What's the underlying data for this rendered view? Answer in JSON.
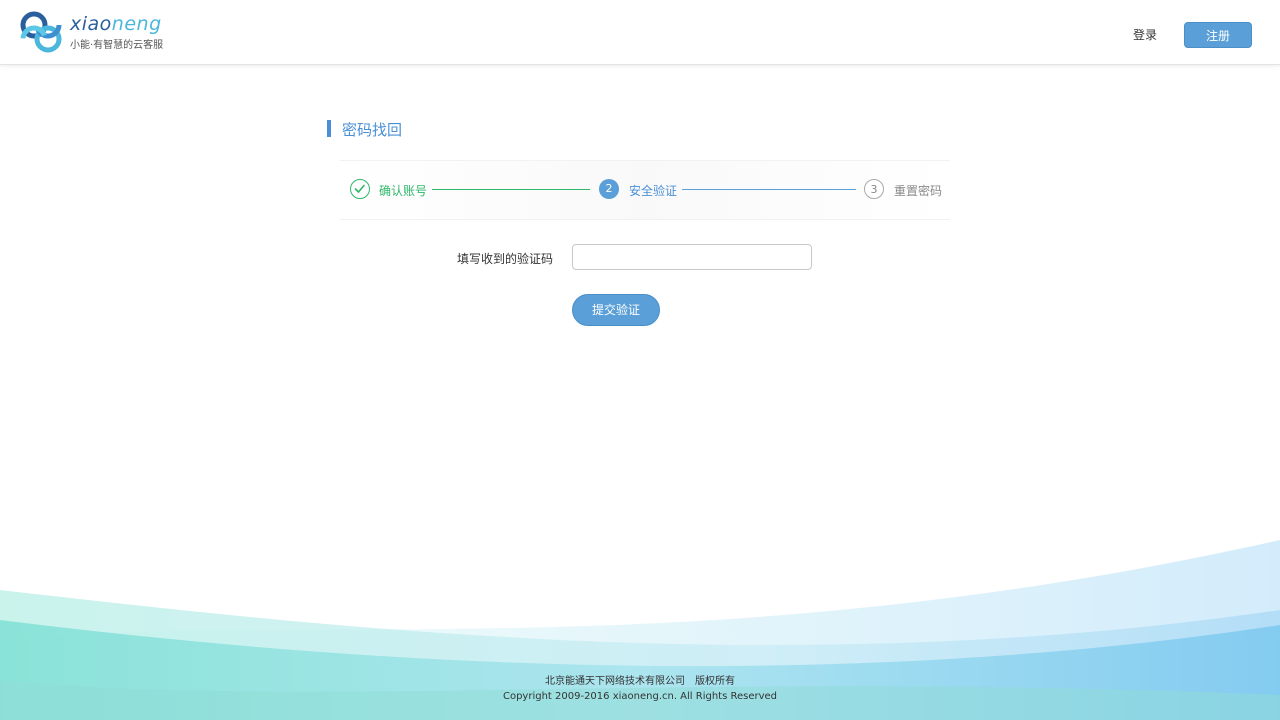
{
  "brand": {
    "word_part1": "xiao",
    "word_part2": "neng",
    "tagline": "小能·有智慧的云客服"
  },
  "header": {
    "login": "登录",
    "register": "注册"
  },
  "title": "密码找回",
  "steps": [
    {
      "number": "✓",
      "label": "确认账号",
      "state": "done"
    },
    {
      "number": "2",
      "label": "安全验证",
      "state": "active"
    },
    {
      "number": "3",
      "label": "重置密码",
      "state": "pending"
    }
  ],
  "form": {
    "code_label": "填写收到的验证码",
    "code_value": "",
    "submit": "提交验证"
  },
  "footer": {
    "company": "北京能通天下网络技术有限公司",
    "rights": "版权所有",
    "copyright": "Copyright 2009-2016 xiaoneng.cn. All Rights Reserved"
  },
  "colors": {
    "accent": "#5a9fd7",
    "success": "#2fb86a",
    "title": "#4a90d6"
  }
}
